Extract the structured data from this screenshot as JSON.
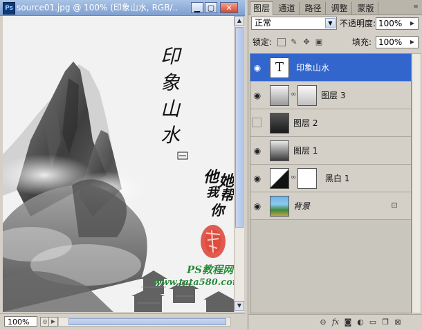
{
  "document": {
    "title": "source01.jpg @ 100% (印象山水, RGB/...",
    "zoom": "100%",
    "artwork": {
      "main_text": [
        "印",
        "象",
        "山",
        "水"
      ],
      "side_text": [
        "他",
        "她",
        "我",
        "帮",
        "你"
      ],
      "watermark_title": "PS教程网",
      "watermark_url": "www.tata580.com"
    }
  },
  "panel": {
    "tabs": [
      "图层",
      "通道",
      "路径",
      "调整",
      "蒙版"
    ],
    "blend_mode": "正常",
    "opacity_label": "不透明度:",
    "opacity_value": "100%",
    "lock_label": "锁定:",
    "fill_label": "填充:",
    "fill_value": "100%",
    "layers": [
      {
        "name": "印象山水",
        "visible": true,
        "selected": true
      },
      {
        "name": "图层 3",
        "visible": true,
        "selected": false
      },
      {
        "name": "图层 2",
        "visible": false,
        "selected": false
      },
      {
        "name": "图层 1",
        "visible": true,
        "selected": false
      },
      {
        "name": "黑白 1",
        "visible": true,
        "selected": false
      },
      {
        "name": "背景",
        "visible": true,
        "selected": false
      }
    ]
  },
  "colors": {
    "selection": "#3266cc",
    "titlebar": "#7f9fd0",
    "seal": "#d8281c",
    "watermark": "#2a8a3a"
  }
}
